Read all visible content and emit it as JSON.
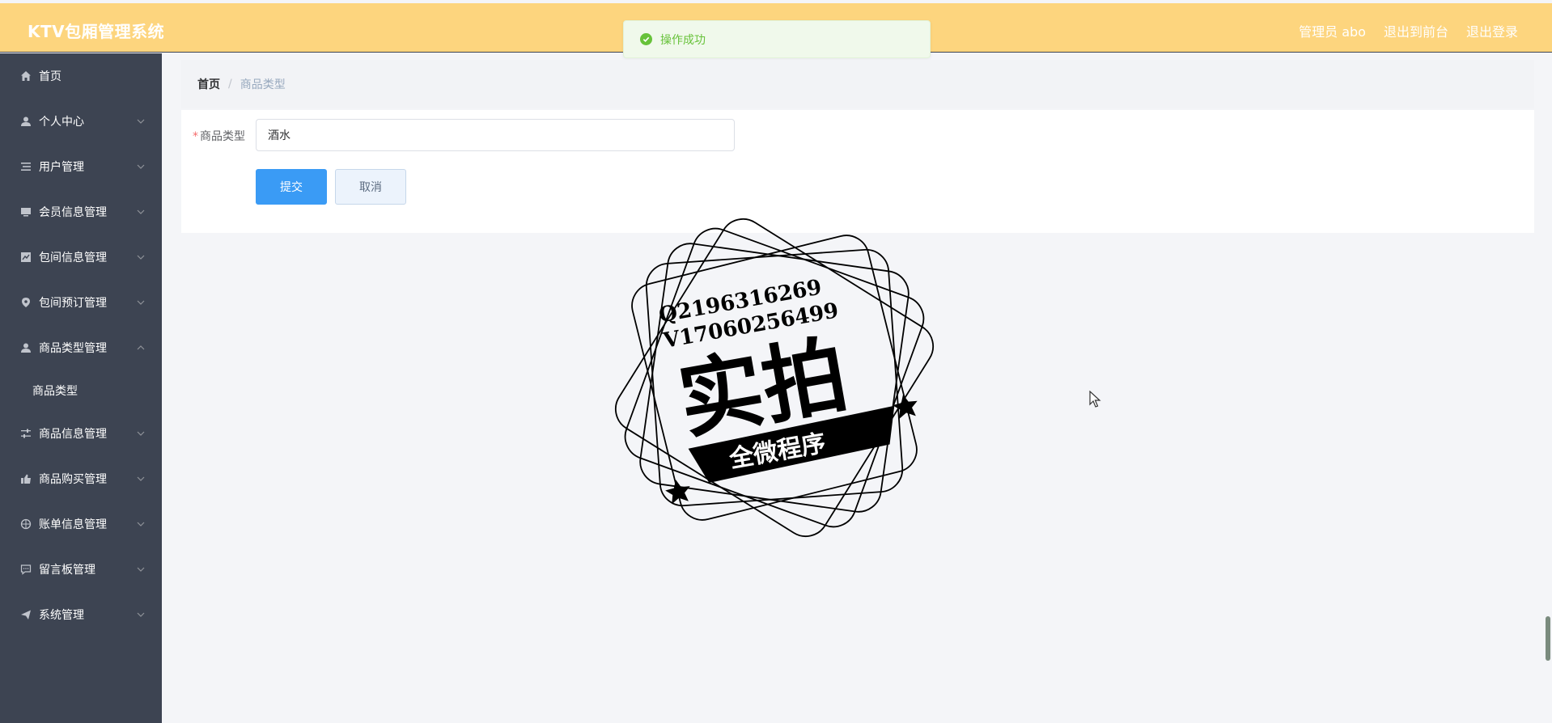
{
  "header": {
    "brand": "KTV包厢管理系统",
    "admin": "管理员 abo",
    "to_frontend": "退出到前台",
    "logout": "退出登录"
  },
  "toast": {
    "message": "操作成功",
    "icon": "check-circle-icon"
  },
  "sidebar": {
    "items": [
      {
        "label": "首页",
        "icon": "home-icon"
      },
      {
        "label": "个人中心",
        "icon": "user-icon"
      },
      {
        "label": "用户管理",
        "icon": "list-icon"
      },
      {
        "label": "会员信息管理",
        "icon": "monitor-icon"
      },
      {
        "label": "包间信息管理",
        "icon": "chart-icon"
      },
      {
        "label": "包间预订管理",
        "icon": "location-icon"
      },
      {
        "label": "商品类型管理",
        "icon": "user-icon",
        "expanded": true
      },
      {
        "label": "商品信息管理",
        "icon": "sliders-icon"
      },
      {
        "label": "商品购买管理",
        "icon": "thumb-icon"
      },
      {
        "label": "账单信息管理",
        "icon": "basketball-icon"
      },
      {
        "label": "留言板管理",
        "icon": "chat-icon"
      },
      {
        "label": "系统管理",
        "icon": "send-icon"
      }
    ],
    "submenu": {
      "label": "商品类型"
    }
  },
  "breadcrumb": {
    "home": "首页",
    "separator": "/",
    "current": "商品类型"
  },
  "form": {
    "label": "商品类型",
    "required_mark": "*",
    "value": "酒水",
    "submit": "提交",
    "cancel": "取消"
  },
  "watermark": {
    "qq": "Q2196316269",
    "vx": "V17060256499",
    "main": "实拍",
    "sub": "全微程序"
  },
  "colors": {
    "header_bg": "#fdd57e",
    "sidebar_bg": "#3d4452",
    "primary": "#3a9bf5",
    "success": "#67c23a"
  }
}
